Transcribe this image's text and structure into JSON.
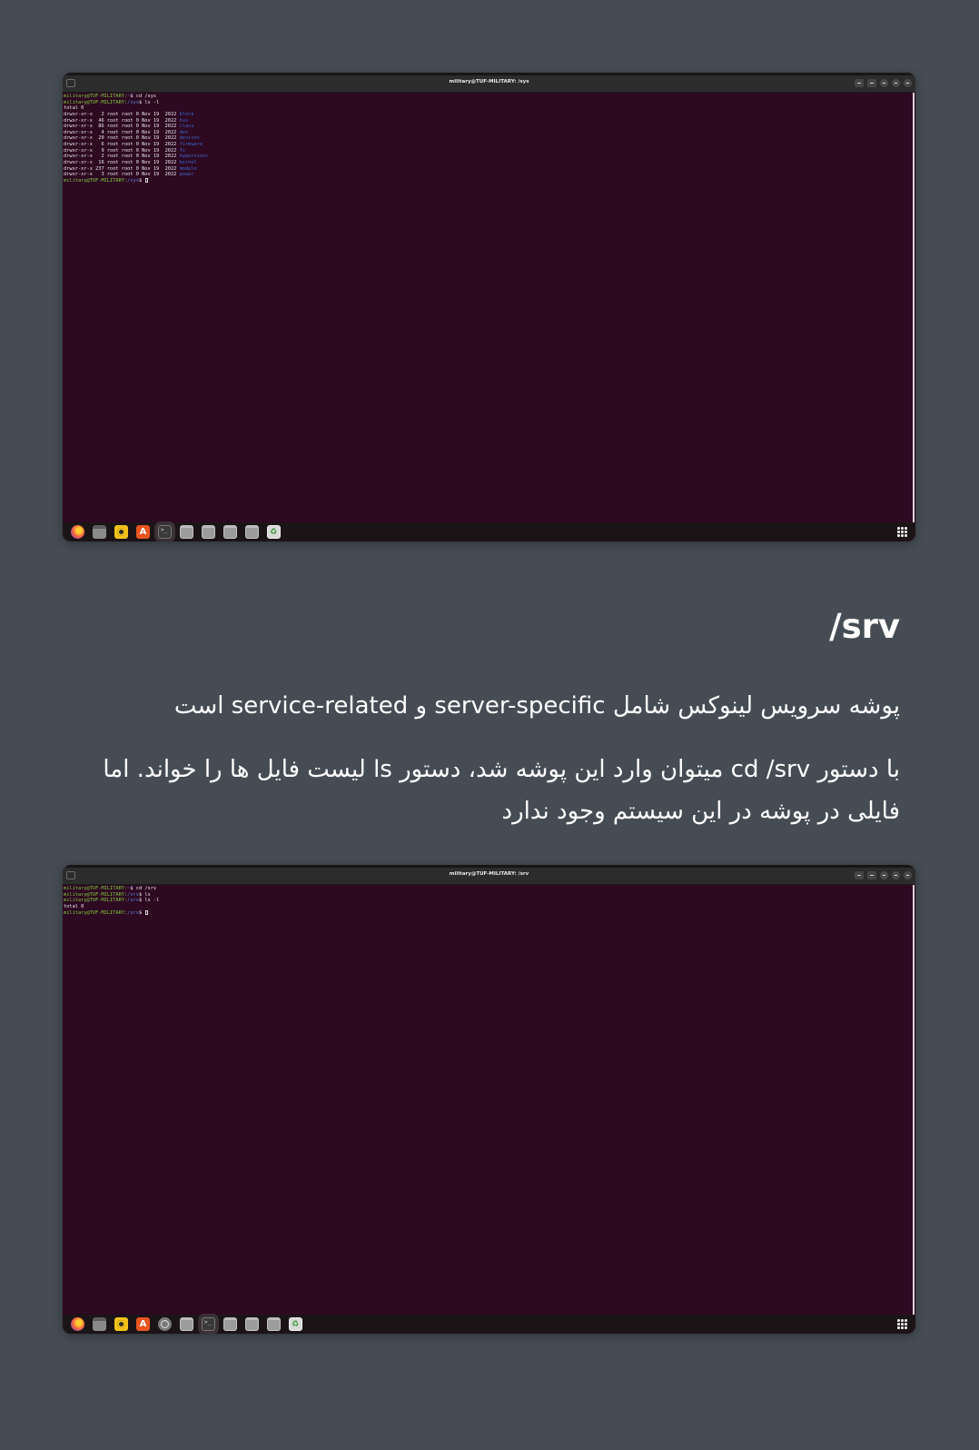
{
  "screenshot_1": {
    "window_title": "military@TUF-MILITARY: /sys",
    "prompt_user": "military@TUF-MILITARY",
    "lines": [
      {
        "kind": "prompt",
        "path": "~",
        "cmd": "cd /sys"
      },
      {
        "kind": "prompt",
        "path": "/sys",
        "cmd": "ls -l"
      },
      {
        "kind": "text",
        "text": "total 0"
      },
      {
        "kind": "dir",
        "meta": "drwxr-xr-x   2 root root 0 Nov 19  2022 ",
        "name": "block"
      },
      {
        "kind": "dir",
        "meta": "drwxr-xr-x  46 root root 0 Nov 19  2022 ",
        "name": "bus"
      },
      {
        "kind": "dir",
        "meta": "drwxr-xr-x  86 root root 0 Nov 19  2022 ",
        "name": "class"
      },
      {
        "kind": "dir",
        "meta": "drwxr-xr-x   4 root root 0 Nov 19  2022 ",
        "name": "dev"
      },
      {
        "kind": "dir",
        "meta": "drwxr-xr-x  20 root root 0 Nov 19  2022 ",
        "name": "devices"
      },
      {
        "kind": "dir",
        "meta": "drwxr-xr-x   6 root root 0 Nov 19  2022 ",
        "name": "firmware"
      },
      {
        "kind": "dir",
        "meta": "drwxr-xr-x   9 root root 0 Nov 19  2022 ",
        "name": "fs"
      },
      {
        "kind": "dir",
        "meta": "drwxr-xr-x   2 root root 0 Nov 19  2022 ",
        "name": "hypervisor"
      },
      {
        "kind": "dir",
        "meta": "drwxr-xr-x  16 root root 0 Nov 19  2022 ",
        "name": "kernel"
      },
      {
        "kind": "dir",
        "meta": "drwxr-xr-x 237 root root 0 Nov 19  2022 ",
        "name": "module"
      },
      {
        "kind": "dir",
        "meta": "drwxr-xr-x   3 root root 0 Nov 19  2022 ",
        "name": "power"
      },
      {
        "kind": "prompt",
        "path": "/sys",
        "cmd": "",
        "cursor": true
      }
    ]
  },
  "heading": "/srv",
  "paragraph_1": "پوشه سرویس لینوکس شامل server-specific و service-related است",
  "paragraph_2": "با دستور cd /srv میتوان وارد این پوشه شد، دستور ls لیست فایل ها را خواند. اما فایلی در پوشه در این سیستم وجود ندارد",
  "screenshot_2": {
    "window_title": "military@TUF-MILITARY: /srv",
    "prompt_user": "military@TUF-MILITARY",
    "lines": [
      {
        "kind": "prompt",
        "path": "~",
        "cmd": "cd /srv"
      },
      {
        "kind": "prompt",
        "path": "/srv",
        "cmd": "ls"
      },
      {
        "kind": "prompt",
        "path": "/srv",
        "cmd": "ls -l"
      },
      {
        "kind": "text",
        "text": "total 0"
      },
      {
        "kind": "prompt",
        "path": "/srv",
        "cmd": "",
        "cursor": true
      }
    ]
  },
  "dock_1": [
    "firefox-icon",
    "files-icon",
    "rhythmbox-icon",
    "app-store-icon",
    "terminal-icon",
    "window-icon",
    "window-icon",
    "window-icon",
    "window-icon",
    "trash-icon"
  ],
  "dock_2": [
    "firefox-icon",
    "files-icon",
    "rhythmbox-icon",
    "app-store-icon",
    "settings-icon",
    "window-icon",
    "terminal-icon",
    "window-icon",
    "window-icon",
    "window-icon",
    "trash-icon"
  ],
  "colors": {
    "page_background": "#454c53",
    "terminal_background": "#2d0922",
    "prompt_user": "#7fcf3a",
    "prompt_path": "#5c7fd6",
    "directory": "#3f66c9"
  }
}
